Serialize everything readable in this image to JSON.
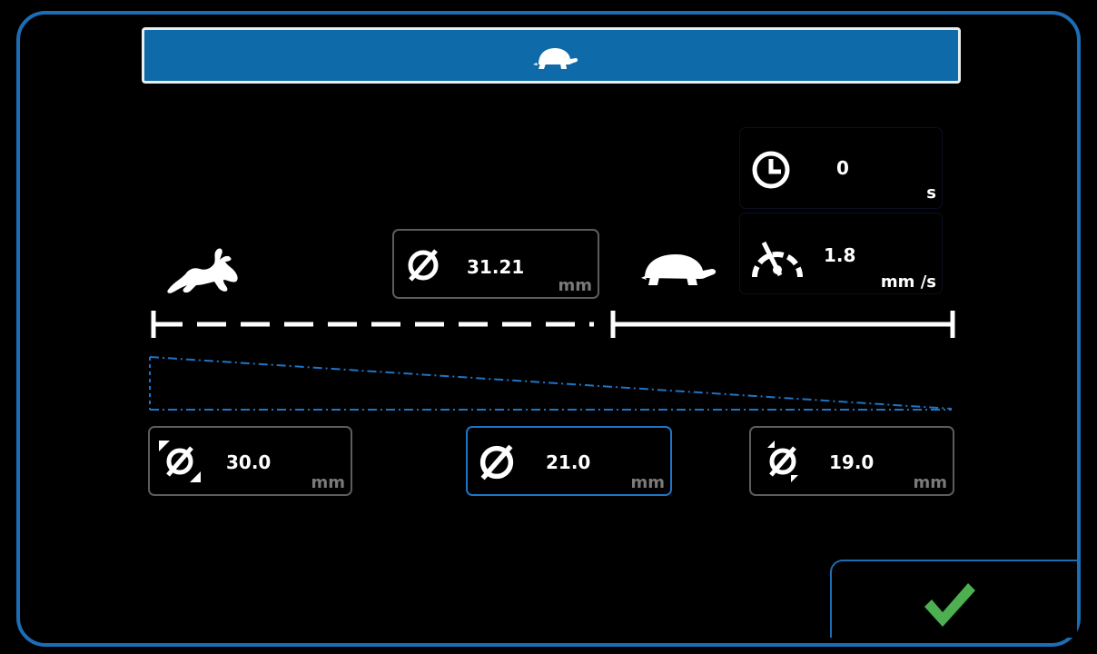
{
  "header": {
    "icon": "turtle-icon",
    "color": "#0e6aa8"
  },
  "speed_indicators": {
    "fast_icon": "rabbit-icon",
    "slow_icon": "turtle-icon"
  },
  "current_diameter": {
    "icon": "diameter-icon",
    "value": "31.21",
    "unit": "mm"
  },
  "timer": {
    "icon": "clock-icon",
    "value": "0",
    "unit": "s"
  },
  "speed": {
    "icon": "speedometer-icon",
    "value": "1.8",
    "unit": "mm /s"
  },
  "diameters": [
    {
      "icon": "diameter-start-icon",
      "value": "30.0",
      "unit": "mm",
      "selected": false
    },
    {
      "icon": "diameter-icon",
      "value": "21.0",
      "unit": "mm",
      "selected": true
    },
    {
      "icon": "diameter-end-icon",
      "value": "19.0",
      "unit": "mm",
      "selected": false
    }
  ],
  "confirm": {
    "icon": "checkmark-icon",
    "color": "#4caf50"
  },
  "colors": {
    "accent": "#1d6db5",
    "field_border": "#5c5c5c",
    "selected_border": "#1f74c4"
  }
}
